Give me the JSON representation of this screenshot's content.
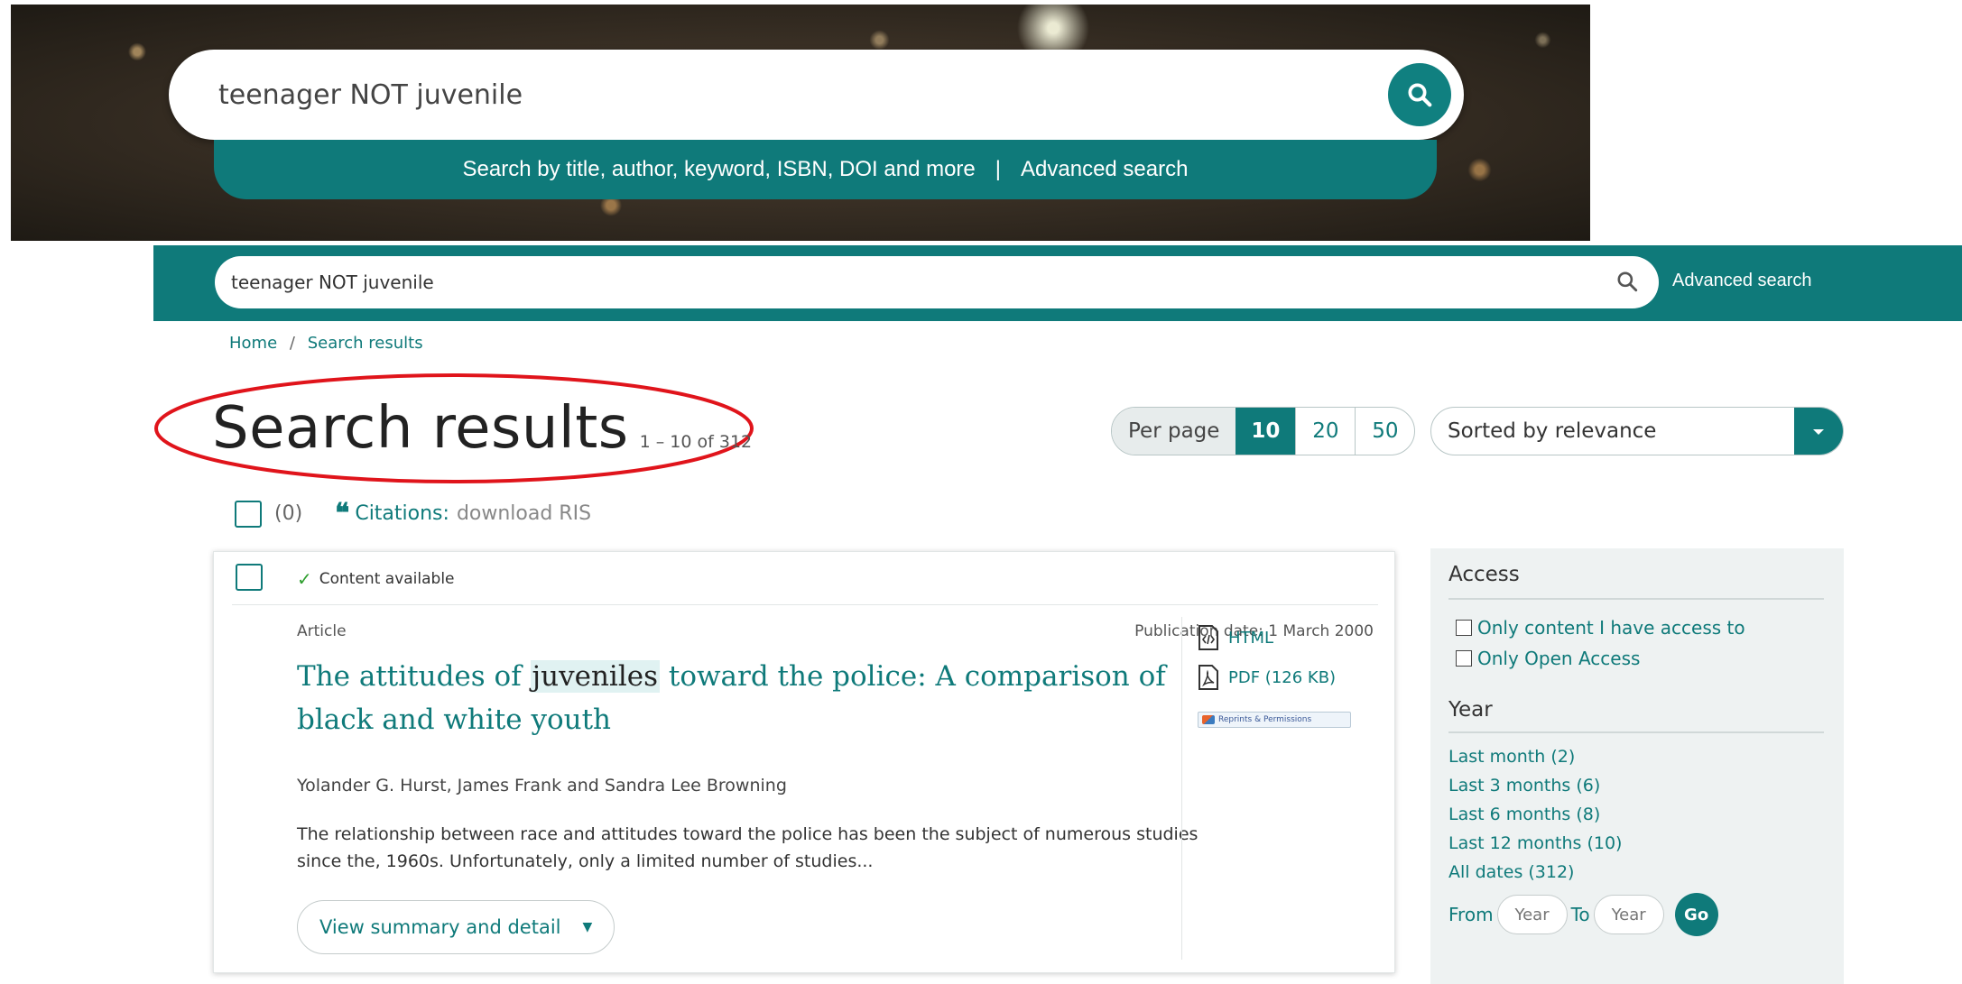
{
  "hero": {
    "search_value": "teenager NOT juvenile",
    "search_icon": "search-icon",
    "tagline": "Search by title, author, keyword, ISBN, DOI and more",
    "separator": "|",
    "advanced_search": "Advanced search"
  },
  "topbar": {
    "search_value": "teenager NOT juvenile",
    "search_icon": "search-icon",
    "advanced_search": "Advanced search"
  },
  "breadcrumb": {
    "home": "Home",
    "separator": "/",
    "current": "Search results"
  },
  "results": {
    "title": "Search results",
    "count": "1 – 10 of 312"
  },
  "per_page": {
    "label": "Per page",
    "options": [
      "10",
      "20",
      "50"
    ],
    "selected": "10"
  },
  "sort": {
    "value": "Sorted by relevance",
    "icon": "caret-down-icon"
  },
  "selection": {
    "count": "(0)",
    "citations_label": "Citations:",
    "citations_link": "download RIS",
    "citations_icon": "quote-icon"
  },
  "result_item": {
    "availability": "Content available",
    "availability_icon": "check-icon",
    "type": "Article",
    "publication_date": "Publication date: 1 March 2000",
    "title_before": "The attitudes of ",
    "title_highlight": "juveniles",
    "title_after": " toward the police: A comparison of black and white youth",
    "authors": "Yolander G. Hurst, James Frank and Sandra Lee Browning",
    "abstract": "The relationship between race and attitudes toward the police has been the subject of numerous studies since the, 1960s. Unfortunately, only a limited number of studies...",
    "summary_button": "View summary and detail",
    "summary_icon": "caret-down-icon",
    "formats": [
      {
        "label": "HTML",
        "icon": "html-file-icon"
      },
      {
        "label": "PDF (126 KB)",
        "icon": "pdf-file-icon"
      }
    ],
    "reprints": "Reprints & Permissions"
  },
  "filters": {
    "access_heading": "Access",
    "access_options": [
      "Only content I have access to",
      "Only Open Access"
    ],
    "year_heading": "Year",
    "year_options": [
      "Last month (2)",
      "Last 3 months (6)",
      "Last 6 months (8)",
      "Last 12 months (10)",
      "All dates (312)"
    ],
    "from_label": "From",
    "to_label": "To",
    "year_placeholder": "Year",
    "go": "Go"
  },
  "colors": {
    "brand_teal": "#0f7a7a",
    "annotation_red": "#e0141b"
  }
}
